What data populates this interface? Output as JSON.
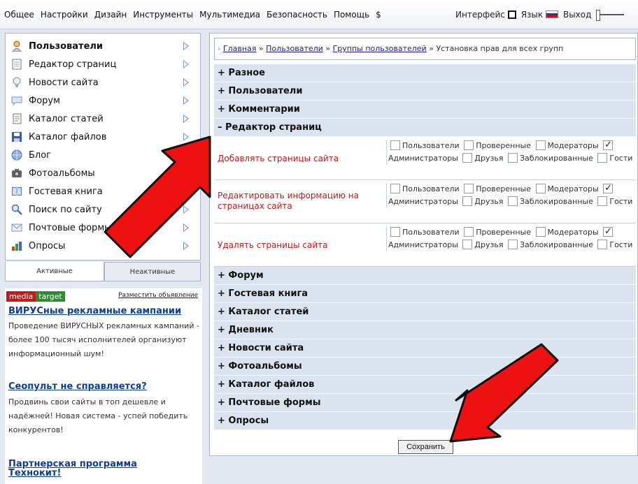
{
  "menu": [
    "Общее",
    "Настройки",
    "Дизайн",
    "Инструменты",
    "Мультимедиа",
    "Безопасность",
    "Помощь",
    "$"
  ],
  "topright": {
    "interface": "Интерфейс",
    "language": "Язык",
    "logout": "Выход"
  },
  "sidebar": {
    "items": [
      {
        "label": "Пользователи",
        "bold": true,
        "arrow": true,
        "icon": "user-icon"
      },
      {
        "label": "Редактор страниц",
        "arrow": true,
        "icon": "page-icon"
      },
      {
        "label": "Новости сайта",
        "arrow": true,
        "icon": "lightbulb-icon"
      },
      {
        "label": "Форум",
        "arrow": true,
        "icon": "speech-bubble-icon"
      },
      {
        "label": "Каталог статей",
        "arrow": true,
        "icon": "document-icon"
      },
      {
        "label": "Каталог файлов",
        "arrow": true,
        "icon": "floppy-disk-icon"
      },
      {
        "label": "Блог",
        "arrow": false,
        "icon": "globe-icon"
      },
      {
        "label": "Фотоальбомы",
        "arrow": false,
        "icon": "camera-icon"
      },
      {
        "label": "Гостевая книга",
        "arrow": true,
        "icon": "book-icon"
      },
      {
        "label": "Поиск по сайту",
        "arrow": true,
        "icon": "magnifier-icon"
      },
      {
        "label": "Почтовые формы",
        "arrow": true,
        "icon": "envelope-icon"
      },
      {
        "label": "Опросы",
        "arrow": true,
        "icon": "bar-chart-icon"
      }
    ],
    "tabs": {
      "active": "Активные",
      "inactive": "Неактивные"
    }
  },
  "ads": {
    "brand1": "media",
    "brand2": "target",
    "place": "Разместить объявление",
    "items": [
      {
        "title": "ВИРУСные рекламные кампании",
        "text": "Проведение ВИРУСНЫХ рекламных кампаний - более 100 тысяч исполнителей организуют информационный шум!"
      },
      {
        "title": "Сеопульт не справляется?",
        "text": "Продвинь свои сайты в топ дешевле и надёжней! Новая система - успей победить конкурентов!"
      },
      {
        "title": "Партнерская программа Технокит!",
        "text": ""
      }
    ]
  },
  "breadcrumb": {
    "items": [
      "Главная",
      "Пользователи",
      "Группы пользователей"
    ],
    "current": "Установка прав для всех групп",
    "sep": "»"
  },
  "sections_top": [
    "+ Разное",
    "+ Пользователи",
    "+ Комментарии"
  ],
  "expanded_section": "– Редактор страниц",
  "group_labels": [
    "Пользователи",
    "Проверенные",
    "Модераторы",
    "Администраторы",
    "Друзья",
    "Заблокированные",
    "Гости"
  ],
  "permissions": [
    {
      "label": "Добавлять страницы сайта",
      "checked": [
        false,
        false,
        false,
        true,
        false,
        false,
        false
      ]
    },
    {
      "label": "Редактировать информацию на страницах сайта",
      "checked": [
        false,
        false,
        false,
        true,
        false,
        false,
        false
      ]
    },
    {
      "label": "Удалять страницы сайта",
      "checked": [
        false,
        false,
        false,
        true,
        false,
        false,
        false
      ]
    }
  ],
  "sections_bottom": [
    "+ Форум",
    "+ Гостевая книга",
    "+ Каталог статей",
    "+ Дневник",
    "+ Новости сайта",
    "+ Фотоальбомы",
    "+ Каталог файлов",
    "+ Почтовые формы",
    "+ Опросы"
  ],
  "save_label": "Сохранить",
  "colors": {
    "accent_red": "#c01818",
    "row_bg": "#dbe3ee",
    "arrow_red": "#ee1111"
  }
}
